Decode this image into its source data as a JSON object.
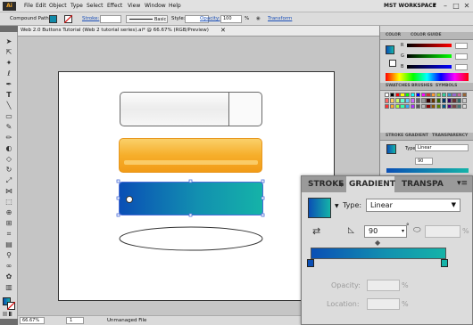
{
  "menubar": {
    "logo": "Ai",
    "items": [
      "File",
      "Edit",
      "Object",
      "Type",
      "Select",
      "Effect",
      "View",
      "Window",
      "Help"
    ],
    "workspace": "MST WORKSPACE",
    "workspace_arrow": "▼",
    "window_buttons": [
      "–",
      "□",
      "✕"
    ]
  },
  "controlbar": {
    "selection": "Compound Path",
    "stroke_label": "Stroke:",
    "profile": "Basic",
    "style_label": "Style:",
    "opacity_label": "Opacity:",
    "opacity_value": "100",
    "opacity_unit": "%",
    "transform_label": "Transform"
  },
  "document": {
    "tab_title": "Web 2.0 Buttons Tutorial (Web 2 tutorial series).ai* @ 66.67% (RGB/Preview)",
    "close": "✕"
  },
  "status": {
    "zoom": "66.67%",
    "page": "1",
    "info": "Unmanaged File"
  },
  "panels": {
    "color_tabs": [
      "COLOR",
      "COLOR GUIDE"
    ],
    "color_sliders": [
      "R",
      "G",
      "B"
    ],
    "swatches_tabs": [
      "SWATCHES",
      "BRUSHES",
      "SYMBOLS"
    ],
    "mini_gradient_tabs": [
      "STROKE",
      "GRADIENT",
      "TRANSPARENCY"
    ],
    "mini_type_label": "Type:",
    "mini_type_value": "Linear",
    "mini_angle": "90"
  },
  "gradient_panel": {
    "tabs": [
      "STROKE",
      "GRADIENT",
      "TRANSPA"
    ],
    "type_label": "Type:",
    "type_value": "Linear",
    "angle_value": "90",
    "angle_unit": "°",
    "aspect_unit": "%",
    "opacity_label": "Opacity:",
    "opacity_unit": "%",
    "location_label": "Location:",
    "location_unit": "%"
  },
  "colors": {
    "gradient_start": "#0a4fb5",
    "gradient_end": "#15b3a8",
    "orange_top": "#f9be3c",
    "orange_bottom": "#f3a01c"
  }
}
